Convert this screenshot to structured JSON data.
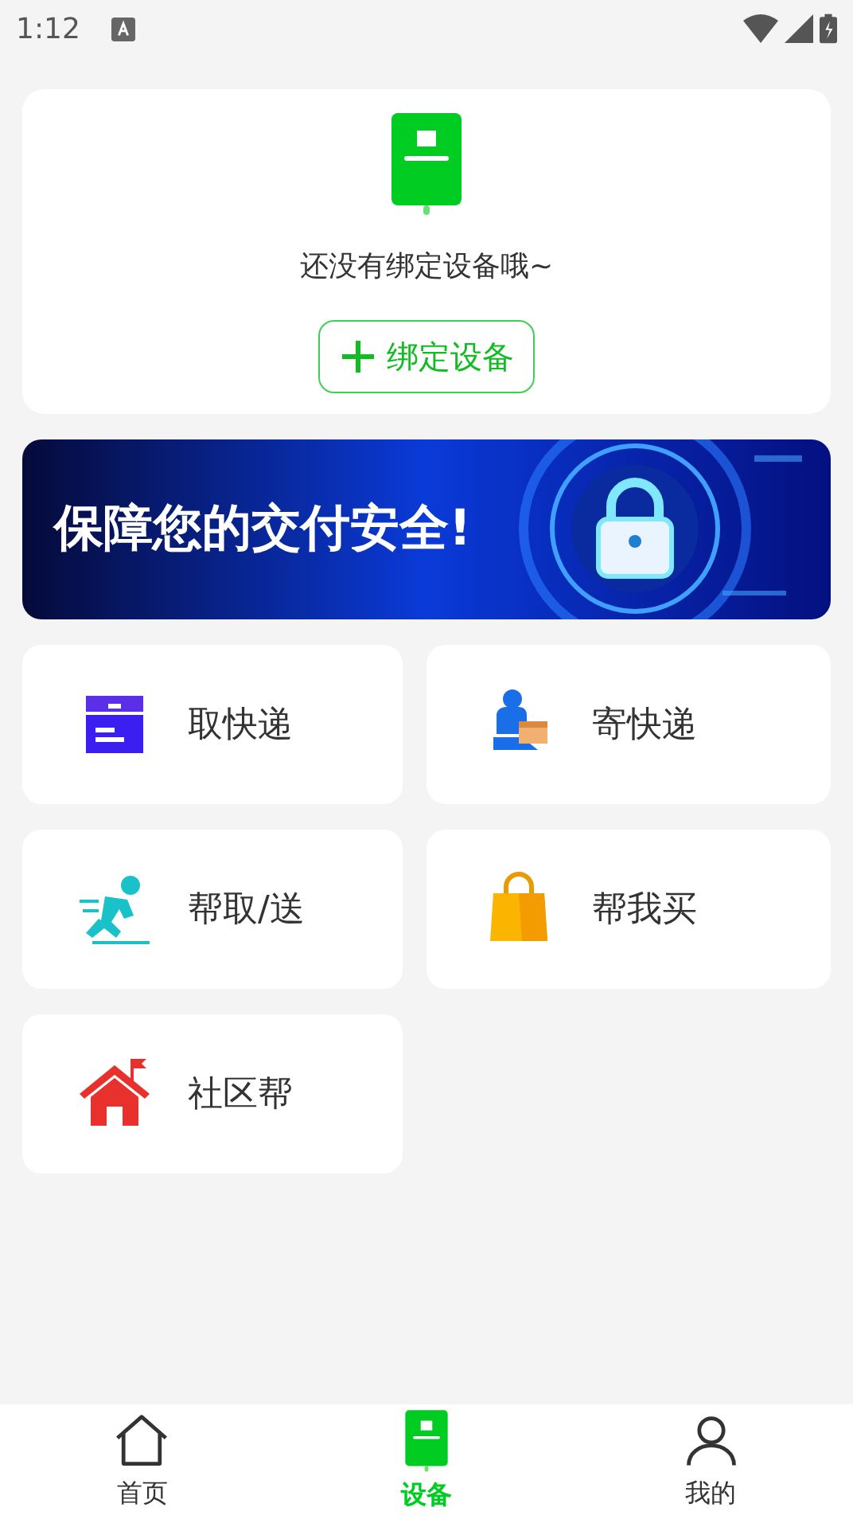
{
  "status_bar": {
    "time": "1:12"
  },
  "device_card": {
    "message": "还没有绑定设备哦~",
    "button": "绑定设备"
  },
  "banner": {
    "text": "保障您的交付安全!"
  },
  "services": [
    {
      "label": "取快递"
    },
    {
      "label": "寄快递"
    },
    {
      "label": "帮取/送"
    },
    {
      "label": "帮我买"
    },
    {
      "label": "社区帮"
    }
  ],
  "bottom_nav": [
    {
      "label": "首页",
      "selected": false
    },
    {
      "label": "设备",
      "selected": true
    },
    {
      "label": "我的",
      "selected": false
    }
  ]
}
